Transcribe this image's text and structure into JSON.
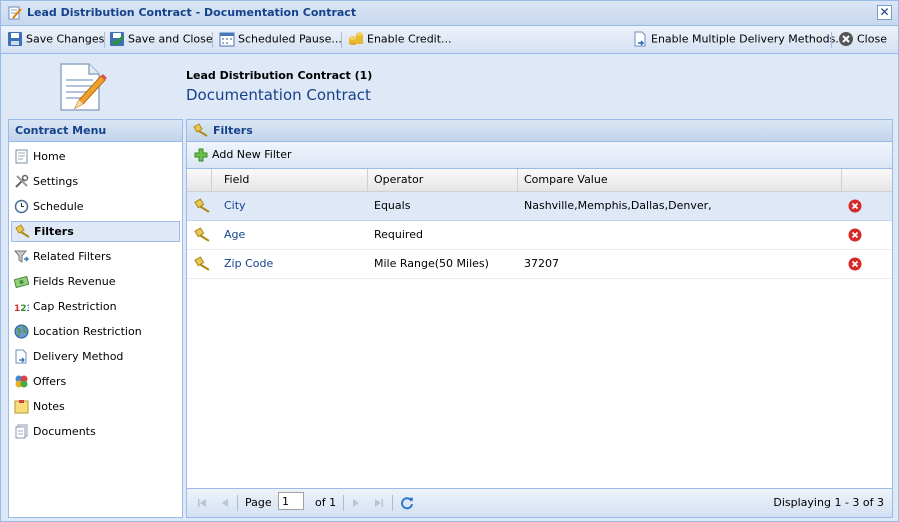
{
  "window": {
    "title": "Lead Distribution Contract - Documentation Contract",
    "close_glyph": "✕"
  },
  "toolbar": {
    "save_changes": "Save Changes",
    "save_close": "Save and Close",
    "scheduled_pause": "Scheduled Pause...",
    "enable_credit": "Enable Credit...",
    "enable_multiple": "Enable Multiple Delivery Methods...",
    "close": "Close"
  },
  "header": {
    "contract_name": "Lead Distribution Contract (1)",
    "subtitle": "Documentation Contract"
  },
  "sidebar": {
    "title": "Contract Menu",
    "items": [
      {
        "label": "Home",
        "icon": "home-icon"
      },
      {
        "label": "Settings",
        "icon": "settings-icon"
      },
      {
        "label": "Schedule",
        "icon": "schedule-icon"
      },
      {
        "label": "Filters",
        "icon": "filter-icon",
        "selected": true
      },
      {
        "label": "Related Filters",
        "icon": "related-filters-icon"
      },
      {
        "label": "Fields Revenue",
        "icon": "money-icon"
      },
      {
        "label": "Cap Restriction",
        "icon": "counter-icon"
      },
      {
        "label": "Location Restriction",
        "icon": "globe-icon"
      },
      {
        "label": "Delivery Method",
        "icon": "document-arrow-icon"
      },
      {
        "label": "Offers",
        "icon": "offers-icon"
      },
      {
        "label": "Notes",
        "icon": "note-icon"
      },
      {
        "label": "Documents",
        "icon": "documents-icon"
      }
    ]
  },
  "filters": {
    "title": "Filters",
    "add_label": "Add New Filter",
    "columns": [
      "Field",
      "Operator",
      "Compare Value"
    ],
    "rows": [
      {
        "field": "City",
        "operator": "Equals",
        "value": "Nashville,Memphis,Dallas,Denver,"
      },
      {
        "field": "Age",
        "operator": "Required",
        "value": ""
      },
      {
        "field": "Zip Code",
        "operator": "Mile Range(50 Miles)",
        "value": "37207"
      }
    ]
  },
  "pager": {
    "page_label": "Page",
    "page_value": "1",
    "of_label": "of 1",
    "display_text": "Displaying 1 - 3 of 3"
  },
  "colors": {
    "accent": "#15428b",
    "border": "#99bbe8",
    "panel_bg": "#dfe8f6"
  }
}
